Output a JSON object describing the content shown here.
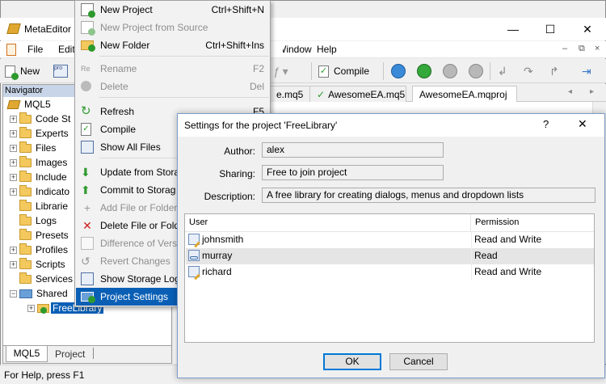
{
  "app": {
    "title": "MetaEditor"
  },
  "window_controls": {
    "minimize": "—",
    "maximize": "☐",
    "close": "✕"
  },
  "menubar": {
    "file": "File",
    "edit": "Edit",
    "window": "Window",
    "help": "Help"
  },
  "toolbar": {
    "new": "New",
    "compile": "Compile"
  },
  "navigator": {
    "title": "Navigator",
    "root": "MQL5",
    "items": [
      "Code St",
      "Experts",
      "Files",
      "Images",
      "Include",
      "Indicato",
      "Librarie",
      "Logs",
      "Presets",
      "Profiles",
      "Scripts",
      "Services",
      "Shared"
    ],
    "shared_child": "FreeLibrary",
    "tabs": [
      "MQL5",
      "Project"
    ]
  },
  "doc_tabs": [
    "e.mq5",
    "AwesomeEA.mq5",
    "AwesomeEA.mqproj"
  ],
  "status": {
    "text": "For Help, press F1"
  },
  "context_menu": {
    "items": [
      {
        "label": "New Project",
        "shortcut": "Ctrl+Shift+N",
        "disabled": false,
        "icon": "new-project-icon"
      },
      {
        "label": "New Project from Source",
        "shortcut": "",
        "disabled": true,
        "icon": "new-project-source-icon"
      },
      {
        "label": "New Folder",
        "shortcut": "Ctrl+Shift+Ins",
        "disabled": false,
        "icon": "new-folder-icon"
      },
      {
        "label": "Rename",
        "shortcut": "F2",
        "disabled": true,
        "icon": "rename-icon"
      },
      {
        "label": "Delete",
        "shortcut": "Del",
        "disabled": true,
        "icon": "delete-icon"
      },
      {
        "label": "Refresh",
        "shortcut": "F5",
        "disabled": false,
        "icon": "refresh-icon"
      },
      {
        "label": "Compile",
        "shortcut": "",
        "disabled": false,
        "icon": "compile-icon"
      },
      {
        "label": "Show All Files",
        "shortcut": "",
        "disabled": false,
        "icon": "show-all-files-icon"
      },
      {
        "label": "Update from Stora",
        "shortcut": "",
        "disabled": false,
        "icon": "update-icon"
      },
      {
        "label": "Commit to Storag",
        "shortcut": "",
        "disabled": false,
        "icon": "commit-icon"
      },
      {
        "label": "Add File or Folder",
        "shortcut": "",
        "disabled": true,
        "icon": "add-file-icon"
      },
      {
        "label": "Delete File or Fold",
        "shortcut": "",
        "disabled": false,
        "icon": "delete-file-icon"
      },
      {
        "label": "Difference of Versi",
        "shortcut": "",
        "disabled": true,
        "icon": "diff-icon"
      },
      {
        "label": "Revert Changes",
        "shortcut": "",
        "disabled": true,
        "icon": "revert-icon"
      },
      {
        "label": "Show Storage Log",
        "shortcut": "",
        "disabled": false,
        "icon": "storage-log-icon"
      },
      {
        "label": "Project Settings",
        "shortcut": "",
        "disabled": false,
        "icon": "project-settings-icon"
      }
    ]
  },
  "dialog": {
    "title": "Settings for the project 'FreeLibrary'",
    "help": "?",
    "close": "✕",
    "author_label": "Author:",
    "author_value": "alex",
    "sharing_label": "Sharing:",
    "sharing_value": "Free to join project",
    "description_label": "Description:",
    "description_value": "A free library for creating dialogs, menus and dropdown lists",
    "columns": [
      "User",
      "Permission"
    ],
    "users": [
      {
        "name": "johnsmith",
        "permission": "Read and Write"
      },
      {
        "name": "murray",
        "permission": "Read"
      },
      {
        "name": "richard",
        "permission": "Read and Write"
      }
    ],
    "ok": "OK",
    "cancel": "Cancel"
  },
  "colors": {
    "selection": "#0a5fb5",
    "folder": "#f3c85d",
    "accent": "#0078d7"
  }
}
